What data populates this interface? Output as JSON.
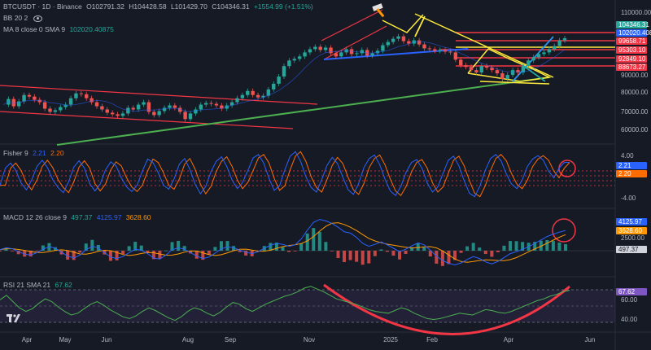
{
  "header": {
    "symbol": "BTCUSDT · 1D · Binance",
    "open": "O102791.32",
    "high": "H104428.58",
    "low": "L101429.70",
    "close": "C104346.31",
    "change": "+1554.99 (+1.51%)",
    "bb_label": "BB 20 2",
    "ma_label": "MA 8 close 0 SMA 9",
    "ma_value": "102020.40875"
  },
  "price_axis": {
    "ticks": [
      "110000.00",
      "90000.00",
      "80000.00",
      "70000.00",
      "60000.00",
      "50000.00"
    ]
  },
  "price_tags": [
    {
      "text": "104346.31",
      "color": "#26a69a"
    },
    {
      "text": "102020.408",
      "color": "#2962ff"
    },
    {
      "text": "99658.71",
      "color": "#f23645"
    },
    {
      "text": "95303.10",
      "color": "#f23645"
    },
    {
      "text": "92849.10",
      "color": "#f23645"
    },
    {
      "text": "88673.27",
      "color": "#f23645"
    }
  ],
  "fisher": {
    "label": "Fisher 9",
    "v1": "2.21",
    "v2": "2.20",
    "ticks": [
      "4.00",
      "-4.00"
    ],
    "tags": [
      {
        "text": "2.21",
        "color": "#2962ff"
      },
      {
        "text": "2.20",
        "color": "#ff6d00"
      }
    ]
  },
  "macd": {
    "label": "MACD 12 26 close 9",
    "hist": "497.37",
    "macd": "4125.97",
    "signal": "3628.60",
    "tick": "2500.00",
    "tags": [
      {
        "text": "4125.97",
        "color": "#2962ff"
      },
      {
        "text": "3628.60",
        "color": "#ff9800"
      },
      {
        "text": "497.37",
        "color": "#d1d4dc"
      }
    ]
  },
  "rsi": {
    "label": "RSI 21 SMA 21",
    "value": "67.62",
    "ticks": [
      "60.00",
      "40.00"
    ],
    "tag": {
      "text": "67.62",
      "color": "#7e57c2"
    }
  },
  "time_axis": [
    "Apr",
    "May",
    "Jun",
    "Aug",
    "Sep",
    "Nov",
    "2025",
    "Feb",
    "Apr",
    "Jun"
  ],
  "chart_data": {
    "type": "line",
    "title": "BTCUSDT · 1D · Binance",
    "series": [
      {
        "name": "BTCUSDT",
        "values": [
          63000,
          66500,
          62000,
          65000,
          69000,
          68000,
          66000,
          64500,
          60500,
          58500,
          59500,
          61500,
          63000,
          67000,
          70000,
          69500,
          67000,
          64500,
          62000,
          60000,
          58000,
          57000,
          56000,
          57500,
          61000,
          60000,
          63000,
          64500,
          58500,
          56500,
          59000,
          61000,
          62500,
          61000,
          58500,
          54000,
          57500,
          60000,
          63000,
          64000,
          63500,
          62500,
          60500,
          62500,
          64500,
          67000,
          69000,
          71500,
          69000,
          67500,
          68500,
          72500,
          76000,
          80500,
          87000,
          90500,
          91500,
          93000,
          95500,
          97500,
          99000,
          97000,
          98500,
          95000,
          93000,
          95500,
          97500,
          94500,
          95000,
          97000,
          93500,
          95000,
          96500,
          100000,
          102000,
          104000,
          105500,
          102500,
          101000,
          103000,
          100500,
          98000,
          97500,
          96500,
          97000,
          96000,
          95500,
          91000,
          87500,
          86500,
          84500,
          83000,
          87000,
          86000,
          84500,
          82500,
          79000,
          81500,
          84500,
          83000,
          87000,
          90500,
          92500,
          94500,
          95500,
          97500,
          99500,
          103000,
          104346
        ]
      }
    ],
    "x_ticks": [
      "Apr",
      "May",
      "Jun",
      "Aug",
      "Sep",
      "Nov",
      "2025",
      "Feb",
      "Apr",
      "Jun"
    ],
    "y_ticks": [
      110000,
      90000,
      80000,
      70000,
      60000,
      50000
    ],
    "ylim": [
      42000,
      118000
    ],
    "indicators": {
      "fisher": [
        -1.8,
        1.2,
        2.1,
        0.8,
        -1.4,
        -2.6,
        -0.9,
        1.5,
        2.6,
        1.3,
        -0.8,
        -2.2,
        -3.1,
        -1.2,
        1.4,
        2.5,
        1.2,
        -1.5,
        -2.8,
        -1.6,
        0.9,
        2.3,
        1.6,
        -0.5,
        -2.1,
        -2.9,
        -1.8,
        0.7,
        2.8,
        2.2,
        0.4,
        -1.8,
        -2.5,
        -0.7,
        1.9,
        2.9,
        1.0,
        -1.6,
        -3.3,
        -2.0,
        0.6,
        2.4,
        3.2,
        1.5,
        -0.9,
        -2.4,
        -1.3,
        0.8,
        3.0,
        3.6,
        2.1,
        -0.6,
        -2.7,
        -1.9,
        0.9,
        3.3,
        4.1,
        2.4,
        -0.3,
        -2.2,
        -3.0,
        -0.8,
        1.7,
        3.1,
        2.0,
        -0.4,
        -2.6,
        -3.4,
        -1.5,
        1.3,
        2.9,
        3.5,
        1.8,
        -0.7,
        -2.8,
        -3.6,
        -2.0,
        0.5,
        2.2,
        2.7,
        1.2,
        -1.4,
        -3.0,
        -2.1,
        0.3,
        2.6,
        3.3,
        1.6,
        -1.0,
        -3.2,
        -3.8,
        -1.9,
        0.8,
        2.9,
        3.6,
        2.5,
        0.2,
        -1.6,
        -2.4,
        -0.9,
        1.5,
        2.8,
        3.4,
        2.6,
        0.7,
        -0.5,
        1.2,
        2.2,
        2.21
      ],
      "macd": [
        200,
        600,
        400,
        -200,
        -700,
        -900,
        -400,
        300,
        800,
        500,
        -300,
        -1100,
        -1500,
        -900,
        200,
        900,
        600,
        -400,
        -1300,
        -1600,
        -1200,
        -400,
        300,
        100,
        -600,
        -1500,
        -1700,
        -900,
        200,
        600,
        300,
        -400,
        -1100,
        -1600,
        -1300,
        -500,
        400,
        800,
        600,
        100,
        -300,
        -600,
        -200,
        500,
        1100,
        1500,
        1300,
        900,
        1200,
        2400,
        4200,
        5800,
        6400,
        6100,
        5600,
        4800,
        3900,
        3600,
        2700,
        1500,
        900,
        1300,
        1800,
        1200,
        500,
        -200,
        300,
        1000,
        1600,
        1200,
        100,
        -1100,
        -2000,
        -2600,
        -2900,
        -2500,
        -1800,
        -1200,
        -1600,
        -2300,
        -2700,
        -2200,
        -1400,
        -600,
        -200,
        300,
        800,
        1500,
        2200,
        2900,
        3400,
        3800,
        4125.97
      ],
      "rsi": [
        57,
        62,
        55,
        48,
        44,
        47,
        53,
        58,
        55,
        49,
        44,
        40,
        42,
        47,
        52,
        55,
        51,
        46,
        42,
        38,
        36,
        39,
        44,
        48,
        45,
        41,
        37,
        34,
        38,
        44,
        48,
        46,
        42,
        39,
        43,
        49,
        54,
        52,
        47,
        44,
        48,
        52,
        55,
        58,
        61,
        63,
        66,
        70,
        72,
        69,
        66,
        62,
        58,
        56,
        54,
        52,
        49,
        46,
        44,
        43,
        42,
        45,
        48,
        46,
        42,
        39,
        36,
        35,
        36,
        38,
        40,
        42,
        41,
        40,
        43,
        46,
        45,
        43,
        42,
        44,
        47,
        50,
        53,
        56,
        58,
        61,
        63,
        66,
        67.62
      ]
    }
  }
}
